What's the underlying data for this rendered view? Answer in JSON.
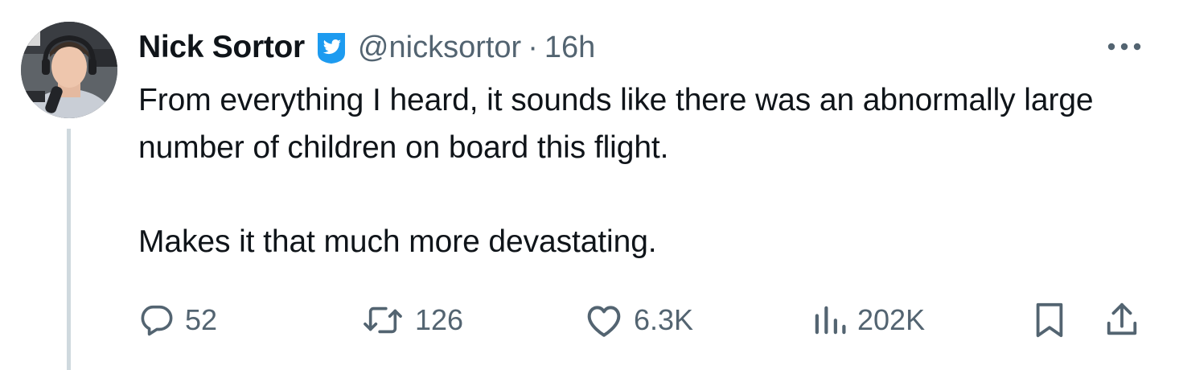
{
  "author": {
    "name": "Nick Sortor",
    "handle": "@nicksortor",
    "separator": "·",
    "time": "16h",
    "verified": true,
    "avatar_icon": "profile-photo"
  },
  "tweet": {
    "paragraphs": [
      "From everything I heard, it sounds like there was an abnormally large number of children on board this flight.",
      "Makes it that much more devastating."
    ]
  },
  "actions": {
    "replies": "52",
    "reposts": "126",
    "likes": "6.3K",
    "views": "202K",
    "icons": [
      "reply-icon",
      "repost-icon",
      "like-icon",
      "views-icon",
      "bookmark-icon",
      "share-icon"
    ]
  },
  "colors": {
    "text": "#0f1419",
    "secondary": "#536471",
    "verified": "#1d9bf0",
    "thread_line": "#cfd9de"
  }
}
